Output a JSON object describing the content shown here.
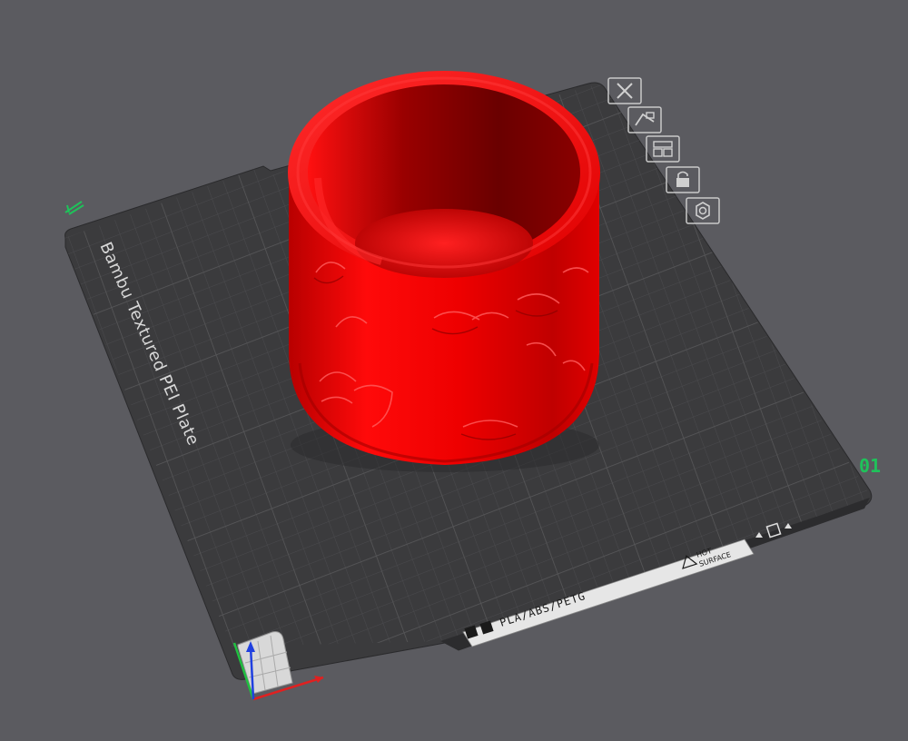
{
  "viewport": {
    "background": "#5b5b60",
    "plate": {
      "label": "Bambu Textured PEI Plate",
      "plate_number": "01",
      "filament_types": "PLA/ABS/PETG",
      "warning_line1": "HOT",
      "warning_line2": "SURFACE",
      "color": "#3b3b3d",
      "grid_color": "#4d4d50",
      "accent_color": "#1fc25a"
    },
    "object": {
      "color": "#e00000",
      "shape": "cylindrical-cup"
    },
    "plate_toolbar": {
      "items": [
        {
          "icon": "close-icon"
        },
        {
          "icon": "auto-orient-icon"
        },
        {
          "icon": "arrange-icon"
        },
        {
          "icon": "lock-icon"
        },
        {
          "icon": "settings-gear-icon"
        }
      ]
    },
    "axes": {
      "x_color": "#e02020",
      "y_color": "#20c040",
      "z_color": "#2040e0"
    }
  }
}
